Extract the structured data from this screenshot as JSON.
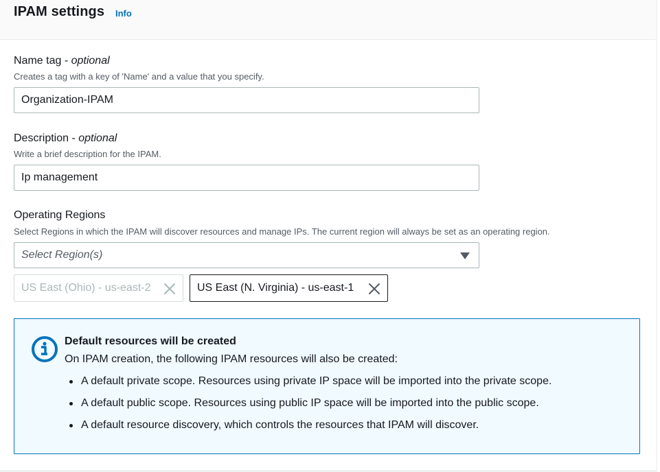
{
  "header": {
    "title": "IPAM settings",
    "info_link": "Info"
  },
  "name_tag": {
    "label": "Name tag",
    "optional": "optional",
    "description": "Creates a tag with a key of 'Name' and a value that you specify.",
    "value": "Organization-IPAM"
  },
  "description_field": {
    "label": "Description",
    "optional": "optional",
    "description": "Write a brief description for the IPAM.",
    "value": "Ip management"
  },
  "operating_regions": {
    "label": "Operating Regions",
    "description": "Select Regions in which the IPAM will discover resources and manage IPs. The current region will always be set as an operating region.",
    "placeholder": "Select Region(s)",
    "tokens": [
      {
        "label": "US East (Ohio) - us-east-2",
        "disabled": true,
        "remove_icon": "close-icon"
      },
      {
        "label": "US East (N. Virginia) - us-east-1",
        "disabled": false,
        "remove_icon": "close-icon"
      }
    ]
  },
  "alert": {
    "icon": "info-icon",
    "title": "Default resources will be created",
    "body": "On IPAM creation, the following IPAM resources will also be created:",
    "items": [
      "A default private scope. Resources using private IP space will be imported into the private scope.",
      "A default public scope. Resources using public IP space will be imported into the public scope.",
      "A default resource discovery, which controls the resources that IPAM will discover."
    ]
  },
  "colors": {
    "link": "#0073bb",
    "alert_border": "#0073bb",
    "alert_background": "#f1faff",
    "text": "#16191f",
    "secondary_text": "#545b64"
  }
}
